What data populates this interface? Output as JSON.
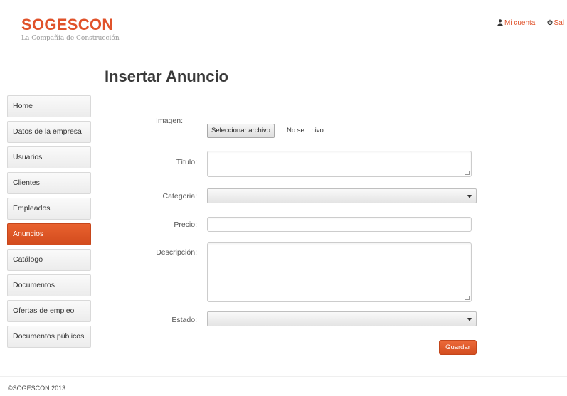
{
  "brand": {
    "name": "SOGESCON",
    "tagline": "La Compañía de Construcción",
    "accent_color": "#e0522a"
  },
  "topnav": {
    "account_icon": "user-icon",
    "account_label": "Mi cuenta",
    "separator": "|",
    "logout_icon": "power-icon",
    "logout_label": "Sal"
  },
  "page": {
    "title": "Insertar Anuncio"
  },
  "sidebar": {
    "items": [
      {
        "label": "Home",
        "active": false
      },
      {
        "label": "Datos de la empresa",
        "active": false
      },
      {
        "label": "Usuarios",
        "active": false
      },
      {
        "label": "Clientes",
        "active": false
      },
      {
        "label": "Empleados",
        "active": false
      },
      {
        "label": "Anuncios",
        "active": true
      },
      {
        "label": "Catálogo",
        "active": false
      },
      {
        "label": "Documentos",
        "active": false
      },
      {
        "label": "Ofertas de empleo",
        "active": false
      },
      {
        "label": "Documentos públicos",
        "active": false
      }
    ]
  },
  "form": {
    "image_label": "Imagen:",
    "file_button": "Seleccionar archivo",
    "file_status": "No se…hivo",
    "title_label": "Título:",
    "title_value": "",
    "category_label": "Categoria:",
    "category_value": "",
    "price_label": "Precio:",
    "price_value": "",
    "description_label": "Descripción:",
    "description_value": "",
    "status_label": "Estado:",
    "status_value": "",
    "submit_label": "Guardar"
  },
  "footer": {
    "copyright": "©SOGESCON 2013"
  }
}
